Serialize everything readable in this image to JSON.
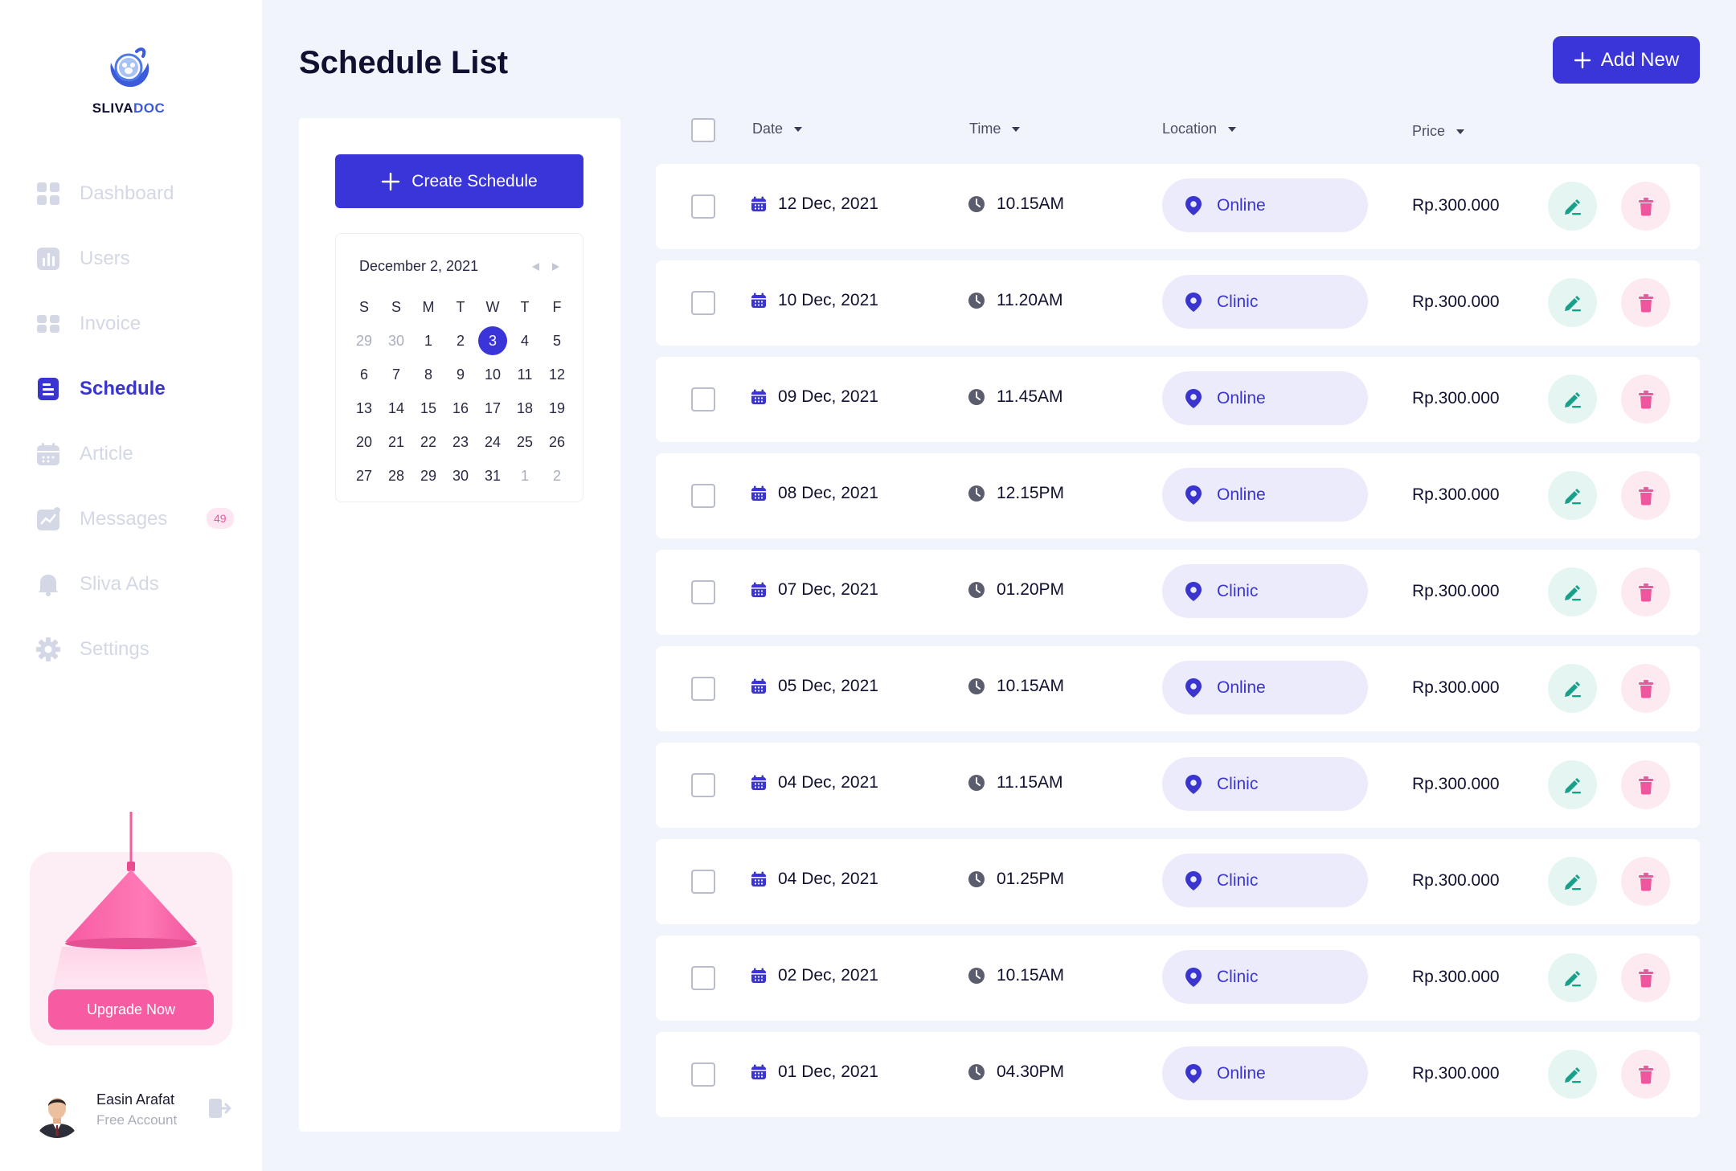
{
  "brand": {
    "name_part1": "SLIVA",
    "name_part2": "DOC"
  },
  "sidebar": {
    "items": [
      {
        "label": "Dashboard",
        "icon": "dashboard-icon"
      },
      {
        "label": "Users",
        "icon": "users-icon"
      },
      {
        "label": "Invoice",
        "icon": "invoice-icon"
      },
      {
        "label": "Schedule",
        "icon": "schedule-icon",
        "active": true
      },
      {
        "label": "Article",
        "icon": "article-icon"
      },
      {
        "label": "Messages",
        "icon": "messages-icon",
        "badge": "49"
      },
      {
        "label": "Sliva Ads",
        "icon": "ads-bell-icon"
      },
      {
        "label": "Settings",
        "icon": "settings-gear-icon"
      }
    ],
    "upgrade": {
      "button": "Upgrade Now"
    },
    "profile": {
      "name": "Easin Arafat",
      "role": "Free Account"
    }
  },
  "header": {
    "title": "Schedule List",
    "add_button": "Add New"
  },
  "panel": {
    "create_button": "Create Schedule",
    "calendar": {
      "title": "December 2, 2021",
      "weekdays": [
        "S",
        "S",
        "M",
        "T",
        "W",
        "T",
        "F"
      ],
      "days": [
        [
          "29",
          "30",
          "1",
          "2",
          "3",
          "4",
          "5"
        ],
        [
          "6",
          "7",
          "8",
          "9",
          "10",
          "11",
          "12"
        ],
        [
          "13",
          "14",
          "15",
          "16",
          "17",
          "18",
          "19"
        ],
        [
          "20",
          "21",
          "22",
          "23",
          "24",
          "25",
          "26"
        ],
        [
          "27",
          "28",
          "29",
          "30",
          "31",
          "1",
          "2"
        ]
      ],
      "selected": "3"
    }
  },
  "table": {
    "columns": {
      "date": "Date",
      "time": "Time",
      "location": "Location",
      "price": "Price"
    },
    "rows": [
      {
        "date": "12 Dec, 2021",
        "time": "10.15AM",
        "location": "Online",
        "price": "Rp.300.000"
      },
      {
        "date": "10 Dec, 2021",
        "time": "11.20AM",
        "location": "Clinic",
        "price": "Rp.300.000"
      },
      {
        "date": "09 Dec, 2021",
        "time": "11.45AM",
        "location": "Online",
        "price": "Rp.300.000"
      },
      {
        "date": "08 Dec, 2021",
        "time": "12.15PM",
        "location": "Online",
        "price": "Rp.300.000"
      },
      {
        "date": "07 Dec, 2021",
        "time": "01.20PM",
        "location": "Clinic",
        "price": "Rp.300.000"
      },
      {
        "date": "05 Dec, 2021",
        "time": "10.15AM",
        "location": "Online",
        "price": "Rp.300.000"
      },
      {
        "date": "04 Dec, 2021",
        "time": "11.15AM",
        "location": "Clinic",
        "price": "Rp.300.000"
      },
      {
        "date": "04 Dec, 2021",
        "time": "01.25PM",
        "location": "Clinic",
        "price": "Rp.300.000"
      },
      {
        "date": "02 Dec, 2021",
        "time": "10.15AM",
        "location": "Clinic",
        "price": "Rp.300.000"
      },
      {
        "date": "01 Dec, 2021",
        "time": "04.30PM",
        "location": "Online",
        "price": "Rp.300.000"
      }
    ]
  },
  "colors": {
    "accent": "#3a35d8",
    "pink": "#f75ba2",
    "teal": "#18a08a",
    "muted": "#d4d8e6"
  }
}
